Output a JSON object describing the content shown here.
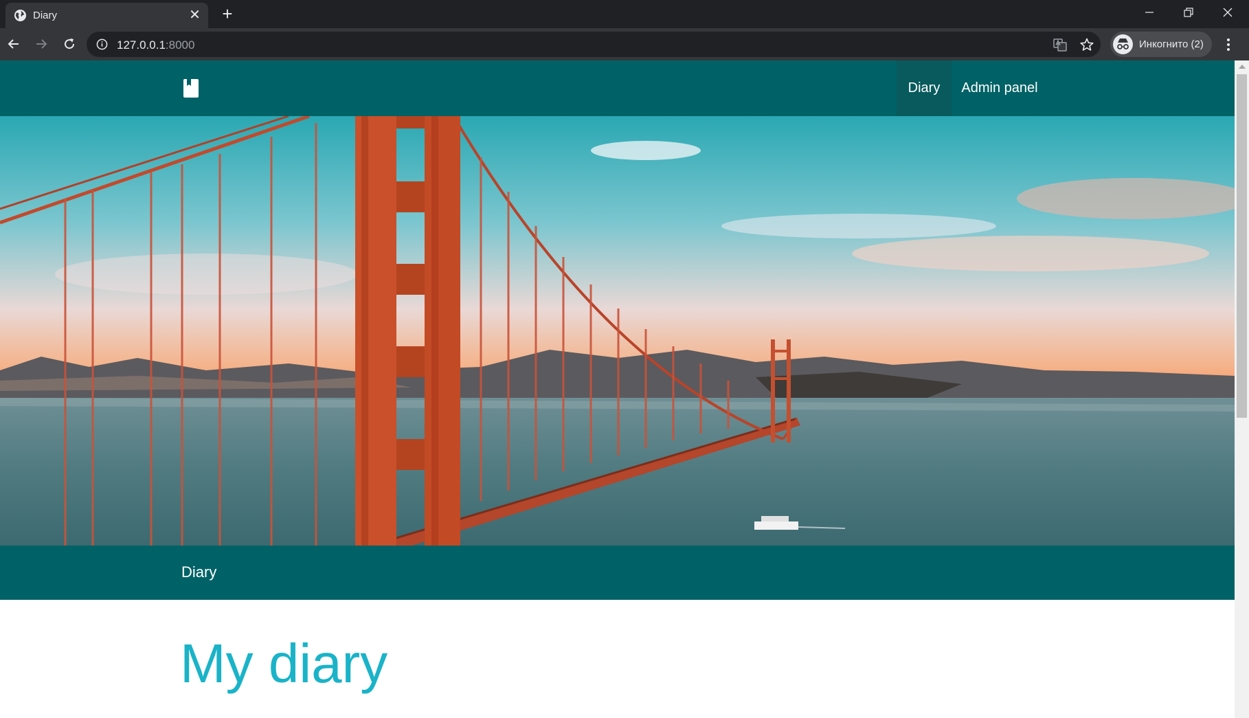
{
  "browser": {
    "tab": {
      "title": "Diary"
    },
    "address": {
      "host": "127.0.0.1",
      "port": ":8000"
    },
    "profile": {
      "label": "Инкогнито (2)"
    }
  },
  "site": {
    "nav": {
      "items": [
        {
          "label": "Diary",
          "active": true
        },
        {
          "label": "Admin panel",
          "active": false
        }
      ]
    },
    "brand_icon": "book-icon",
    "hero_image": "golden-gate-bridge-photo",
    "subbar": {
      "title": "Diary"
    },
    "page_title": "My diary"
  },
  "colors": {
    "nav_bg": "#006266",
    "nav_active_bg": "#085a5d",
    "title_color": "#1ab3c8"
  }
}
